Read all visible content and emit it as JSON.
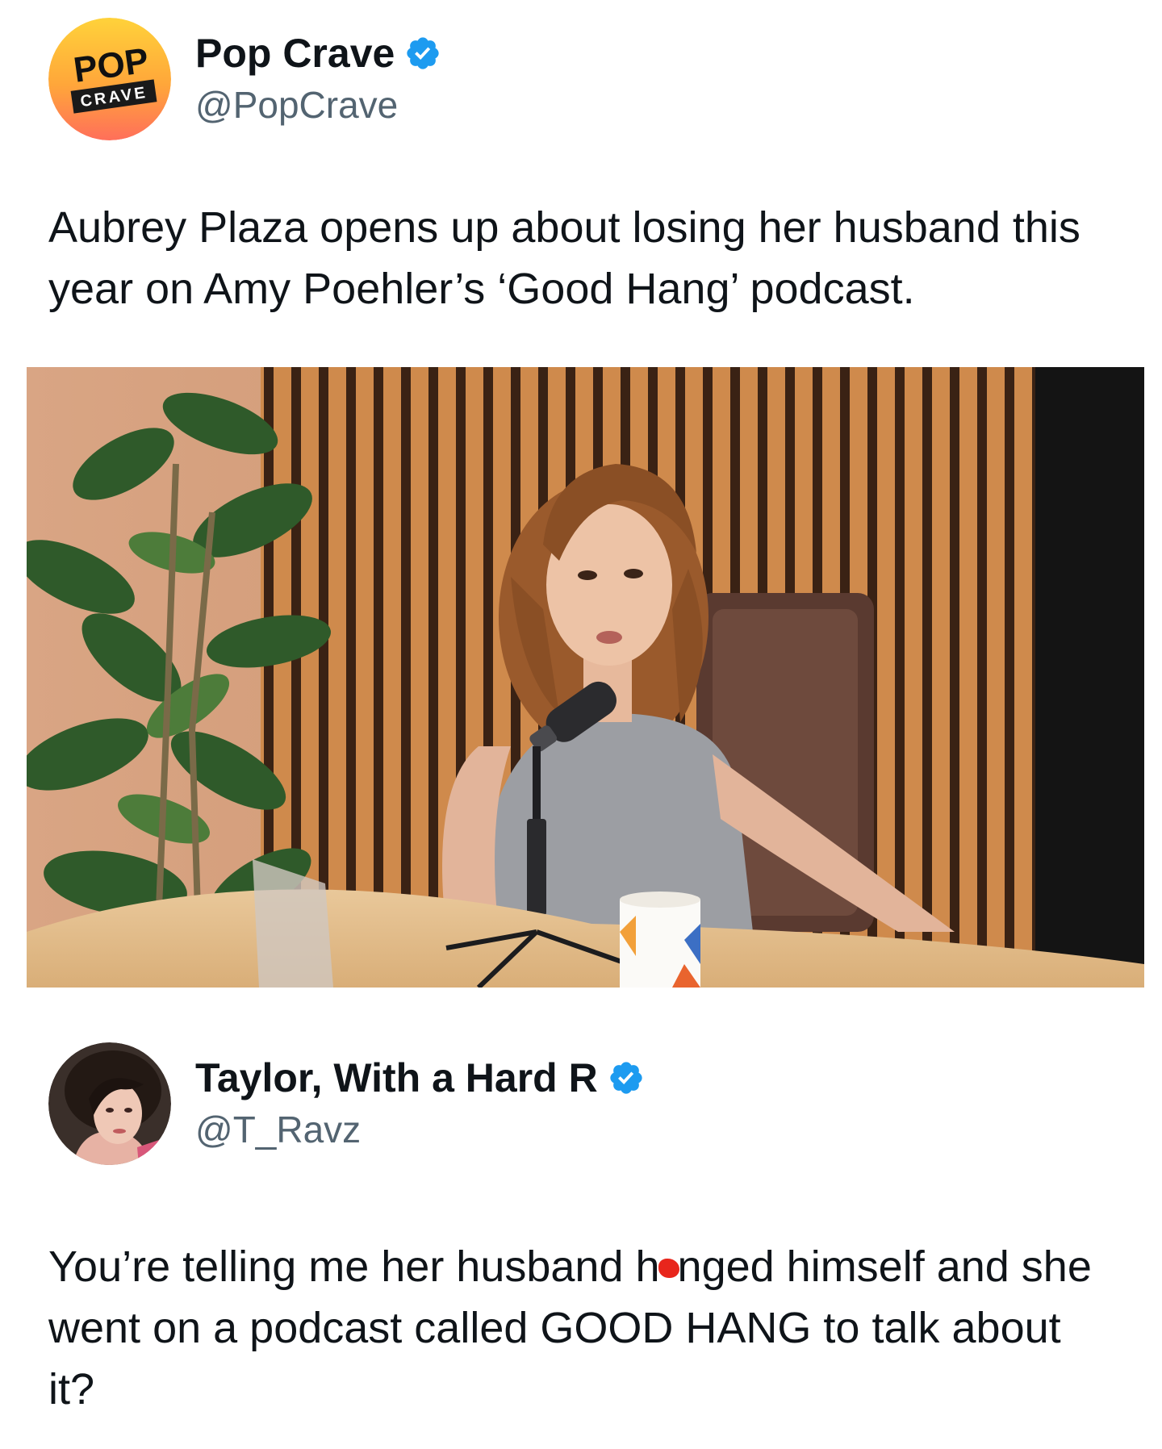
{
  "original_tweet": {
    "display_name": "Pop Crave",
    "handle": "@PopCrave",
    "avatar_logo": {
      "top": "POP",
      "bottom": "CRAVE"
    },
    "verified": true,
    "text": "Aubrey Plaza opens up about losing her husband this year on Amy Poehler’s ‘Good Hang’ podcast.",
    "media": {
      "type": "video-still"
    }
  },
  "reply_tweet": {
    "display_name": "Taylor, With a Hard R",
    "handle": "@T_Ravz",
    "verified": true,
    "text_part1": "You’re telling me her husband h",
    "text_part2": "nged himself and she went on a podcast called GOOD HANG to talk about it?"
  },
  "colors": {
    "verified_blue": "#1d9bf0",
    "handle_gray": "#536471",
    "redaction_red": "#e8261c"
  }
}
